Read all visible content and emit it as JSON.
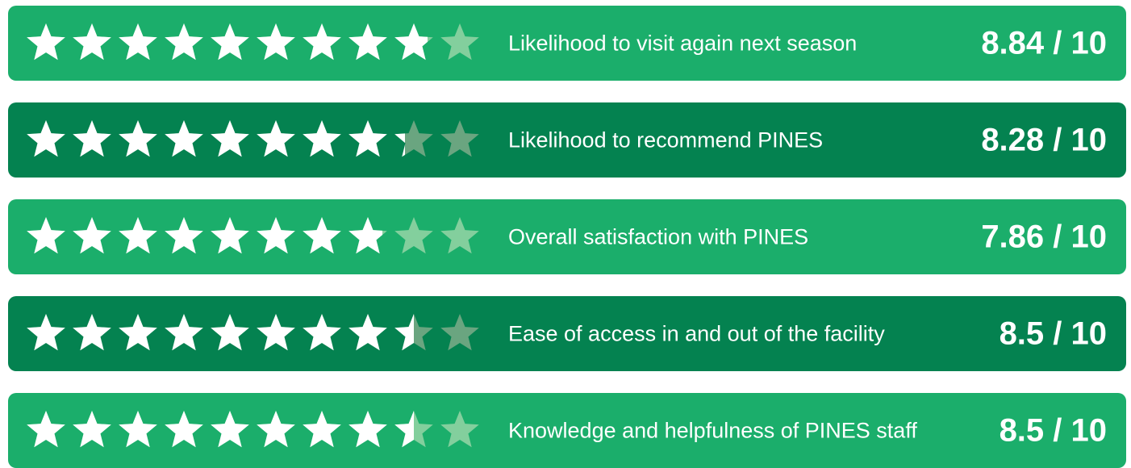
{
  "colors": {
    "light_row": "#1bae6b",
    "dark_row": "#048250",
    "star_filled": "#ffffff",
    "star_empty_light_row": "#83cf9d",
    "star_empty_dark_row": "#6aa580"
  },
  "chart_data": {
    "type": "rating",
    "max": 10,
    "stars": 10,
    "items": [
      {
        "label": "Likelihood to visit again next season",
        "value": 8.84,
        "display": "8.84 / 10",
        "shade": "light"
      },
      {
        "label": "Likelihood to recommend PINES",
        "value": 8.28,
        "display": "8.28 / 10",
        "shade": "dark"
      },
      {
        "label": "Overall satisfaction with PINES",
        "value": 7.86,
        "display": "7.86 / 10",
        "shade": "light"
      },
      {
        "label": "Ease of access in and out of the facility",
        "value": 8.5,
        "display": "8.5 / 10",
        "shade": "dark"
      },
      {
        "label": "Knowledge and helpfulness of PINES staff",
        "value": 8.5,
        "display": "8.5 / 10",
        "shade": "light"
      }
    ]
  }
}
